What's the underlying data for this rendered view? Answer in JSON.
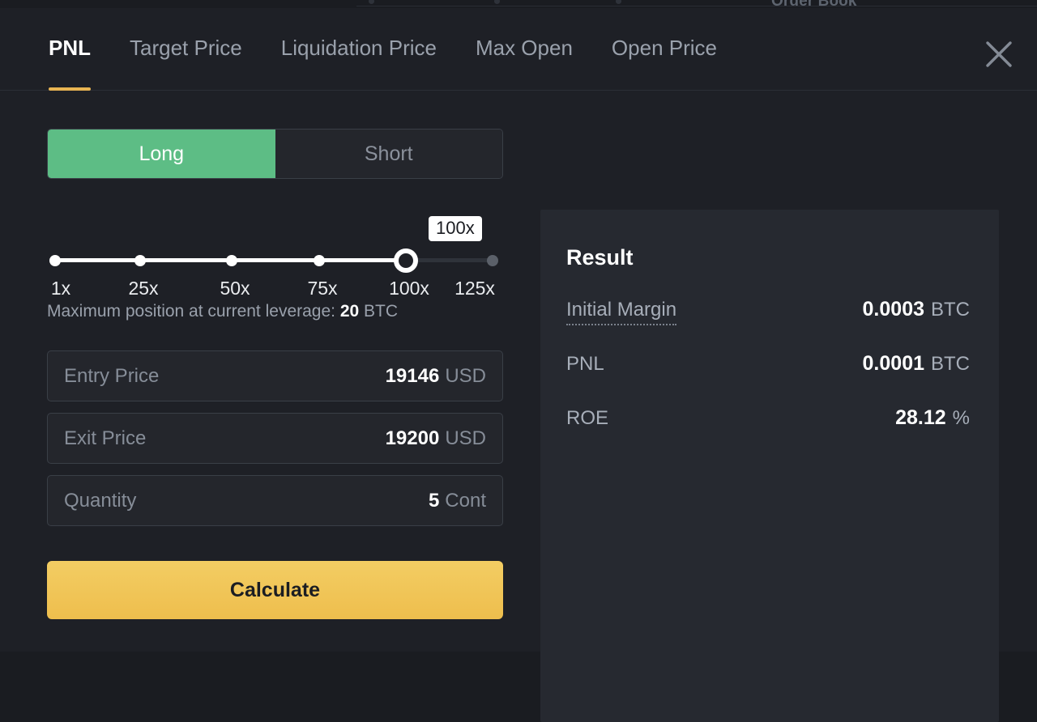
{
  "background": {
    "order_book_label": "Order Book"
  },
  "header": {
    "tabs": [
      {
        "label": "PNL",
        "active": true
      },
      {
        "label": "Target Price",
        "active": false
      },
      {
        "label": "Liquidation Price",
        "active": false
      },
      {
        "label": "Max Open",
        "active": false
      },
      {
        "label": "Open Price",
        "active": false
      }
    ],
    "close_icon": "close-icon",
    "accent_color": "#e8b452"
  },
  "side_toggle": {
    "long_label": "Long",
    "short_label": "Short",
    "selected": "Long",
    "long_color": "#5dbd85"
  },
  "leverage_slider": {
    "bubble_label": "100x",
    "current_value": "100x",
    "min_label": "1x",
    "max_label": "125x",
    "ticks": [
      {
        "label": "1x",
        "pct": 0
      },
      {
        "label": "25x",
        "pct": 19.5
      },
      {
        "label": "50x",
        "pct": 40.3
      },
      {
        "label": "75x",
        "pct": 60.1
      },
      {
        "label": "100x",
        "pct": 80.4
      },
      {
        "label": "125x",
        "pct": 100
      }
    ],
    "max_position_prefix": "Maximum position at current leverage:",
    "max_position_value": "20",
    "max_position_unit": "BTC"
  },
  "inputs": [
    {
      "label": "Entry Price",
      "value": "19146",
      "unit": "USD",
      "name": "entry-price"
    },
    {
      "label": "Exit Price",
      "value": "19200",
      "unit": "USD",
      "name": "exit-price"
    },
    {
      "label": "Quantity",
      "value": "5",
      "unit": "Cont",
      "name": "quantity"
    }
  ],
  "calculate_button": {
    "label": "Calculate"
  },
  "result": {
    "title": "Result",
    "rows": [
      {
        "label": "Initial Margin",
        "value": "0.0003",
        "unit": "BTC",
        "hinted": true
      },
      {
        "label": "PNL",
        "value": "0.0001",
        "unit": "BTC",
        "hinted": false
      },
      {
        "label": "ROE",
        "value": "28.12",
        "unit": "%",
        "hinted": false
      }
    ]
  }
}
